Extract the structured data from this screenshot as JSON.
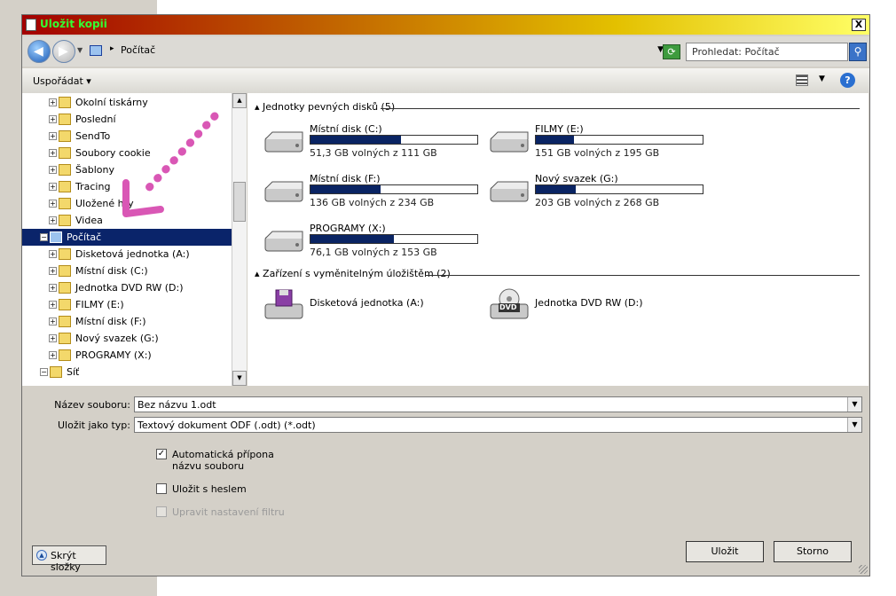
{
  "window": {
    "title": "Uložit kopii",
    "close_label": "X"
  },
  "address": {
    "location": "Počítač",
    "search_placeholder": "Prohledat: Počítač"
  },
  "toolbar": {
    "organize_label": "Uspořádat"
  },
  "tree": {
    "items": [
      {
        "label": "Okolní tiskárny",
        "depth": 2,
        "expander": "+",
        "selected": false
      },
      {
        "label": "Poslední",
        "depth": 2,
        "expander": "+",
        "selected": false
      },
      {
        "label": "SendTo",
        "depth": 2,
        "expander": "+",
        "selected": false
      },
      {
        "label": "Soubory cookie",
        "depth": 2,
        "expander": "+",
        "selected": false
      },
      {
        "label": "Šablony",
        "depth": 2,
        "expander": "+",
        "selected": false
      },
      {
        "label": "Tracing",
        "depth": 2,
        "expander": "+",
        "selected": false
      },
      {
        "label": "Uložené hry",
        "depth": 2,
        "expander": "+",
        "selected": false
      },
      {
        "label": "Videa",
        "depth": 2,
        "expander": "+",
        "selected": false
      },
      {
        "label": "Počítač",
        "depth": 1,
        "expander": "−",
        "selected": true
      },
      {
        "label": "Disketová jednotka (A:)",
        "depth": 2,
        "expander": "+",
        "selected": false
      },
      {
        "label": "Místní disk (C:)",
        "depth": 2,
        "expander": "+",
        "selected": false
      },
      {
        "label": "Jednotka DVD RW (D:)",
        "depth": 2,
        "expander": "+",
        "selected": false
      },
      {
        "label": "FILMY (E:)",
        "depth": 2,
        "expander": "+",
        "selected": false
      },
      {
        "label": "Místní disk (F:)",
        "depth": 2,
        "expander": "+",
        "selected": false
      },
      {
        "label": "Nový svazek (G:)",
        "depth": 2,
        "expander": "+",
        "selected": false
      },
      {
        "label": "PROGRAMY (X:)",
        "depth": 2,
        "expander": "+",
        "selected": false
      },
      {
        "label": "Síť",
        "depth": 1,
        "expander": "−",
        "selected": false
      }
    ]
  },
  "groups": {
    "hard_drives": "Jednotky pevných disků (5)",
    "removable": "Zařízení s vyměnitelným úložištěm (2)"
  },
  "drives": [
    {
      "name": "Místní disk (C:)",
      "free": "51,3 GB volných z 111 GB",
      "used_fraction": 0.54
    },
    {
      "name": "FILMY (E:)",
      "free": "151 GB volných z 195 GB",
      "used_fraction": 0.23
    },
    {
      "name": "Místní disk (F:)",
      "free": "136 GB volných z 234 GB",
      "used_fraction": 0.42
    },
    {
      "name": "Nový svazek (G:)",
      "free": "203 GB volných z 268 GB",
      "used_fraction": 0.24
    },
    {
      "name": "PROGRAMY (X:)",
      "free": "76,1 GB volných z 153 GB",
      "used_fraction": 0.5
    }
  ],
  "devices": [
    {
      "name": "Disketová jednotka (A:)",
      "icon": "floppy-drive-icon"
    },
    {
      "name": "Jednotka DVD RW (D:)",
      "icon": "dvd-drive-icon",
      "badge": "DVD"
    }
  ],
  "form": {
    "filename_label": "Název souboru:",
    "filename_value": "Bez názvu 1.odt",
    "filetype_label": "Uložit jako typ:",
    "filetype_value": "Textový dokument ODF (.odt) (*.odt)",
    "auto_ext_line1": "Automatická přípona",
    "auto_ext_line2": "názvu souboru",
    "auto_ext_checked": true,
    "password_label": "Uložit s heslem",
    "password_checked": false,
    "filter_label": "Upravit nastavení filtru",
    "filter_enabled": false
  },
  "buttons": {
    "hide_folders": "Skrýt složky",
    "save": "Uložit",
    "cancel": "Storno"
  },
  "colors": {
    "selection": "#0a246a",
    "bar_fill": "#0a2463",
    "annotation": "#d957b5",
    "title_text": "#33ff33"
  }
}
